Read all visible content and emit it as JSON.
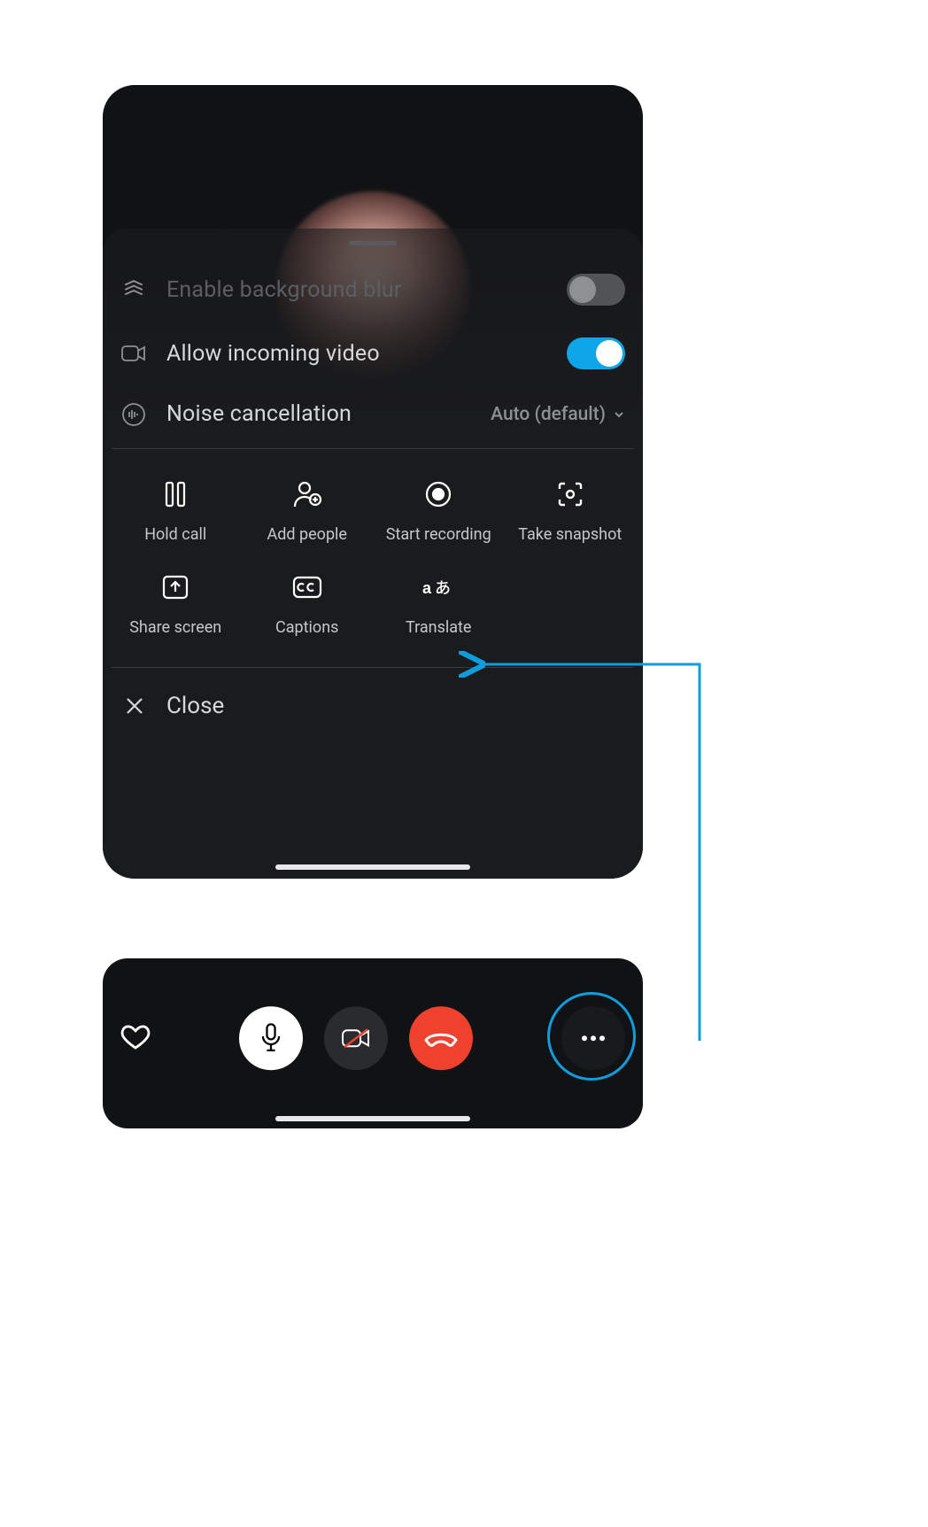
{
  "colors": {
    "accent": "#0e9ee0",
    "toggle_on": "#0fa5e9",
    "hangup": "#ee412e"
  },
  "sheet": {
    "rows": {
      "blur": {
        "label": "Enable background blur",
        "enabled": false,
        "toggled": false
      },
      "video": {
        "label": "Allow incoming video",
        "enabled": true,
        "toggled": true
      },
      "noise": {
        "label": "Noise cancellation",
        "value": "Auto (default)"
      }
    },
    "actions": [
      {
        "id": "hold",
        "label": "Hold call"
      },
      {
        "id": "add",
        "label": "Add people"
      },
      {
        "id": "record",
        "label": "Start recording"
      },
      {
        "id": "snapshot",
        "label": "Take snapshot"
      },
      {
        "id": "share",
        "label": "Share screen"
      },
      {
        "id": "captions",
        "label": "Captions"
      },
      {
        "id": "translate",
        "label": "Translate"
      }
    ],
    "close_label": "Close"
  },
  "callbar": {
    "buttons": {
      "react": "heart",
      "mic": "microphone",
      "camera": "camera-off",
      "hangup": "phone-down",
      "more": "more"
    }
  },
  "annotation": {
    "from_button": "more",
    "to_action": "translate"
  }
}
